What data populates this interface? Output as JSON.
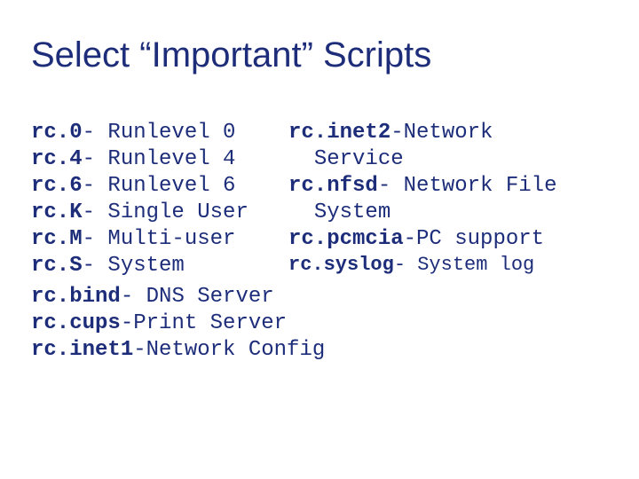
{
  "title": "Select “Important” Scripts",
  "left": {
    "r0": {
      "name": "rc.0",
      "sep": "- ",
      "desc": "Runlevel 0"
    },
    "r1": {
      "name": "rc.4",
      "sep": "- ",
      "desc": "Runlevel 4"
    },
    "r2": {
      "name": "rc.6",
      "sep": "- ",
      "desc": "Runlevel 6"
    },
    "r3": {
      "name": "rc.K",
      "sep": "- ",
      "desc": "Single User"
    },
    "r4": {
      "name": "rc.M",
      "sep": "- ",
      "desc": "Multi-user"
    },
    "r5": {
      "name": "rc.S",
      "sep": "- ",
      "desc": "System"
    }
  },
  "right": {
    "r0_name": "rc.inet2",
    "r0_sep": "-",
    "r0_desc": "Network",
    "r0b_desc": "Service",
    "r1_name": "rc.nfsd",
    "r1_sep": "- ",
    "r1_desc": "Network File",
    "r1b_desc": "System",
    "r2_name": "rc.pcmcia",
    "r2_sep": "-",
    "r2_desc": "PC support",
    "r3_name": "rc.syslog",
    "r3_sep": "- ",
    "r3_desc": "System log"
  },
  "bottom": {
    "b0": {
      "name": "rc.bind",
      "sep": "- ",
      "desc": "DNS Server"
    },
    "b1": {
      "name": "rc.cups",
      "sep": "-",
      "desc": "Print Server"
    },
    "b2": {
      "name": "rc.inet1",
      "sep": "-",
      "desc": "Network Config"
    }
  }
}
